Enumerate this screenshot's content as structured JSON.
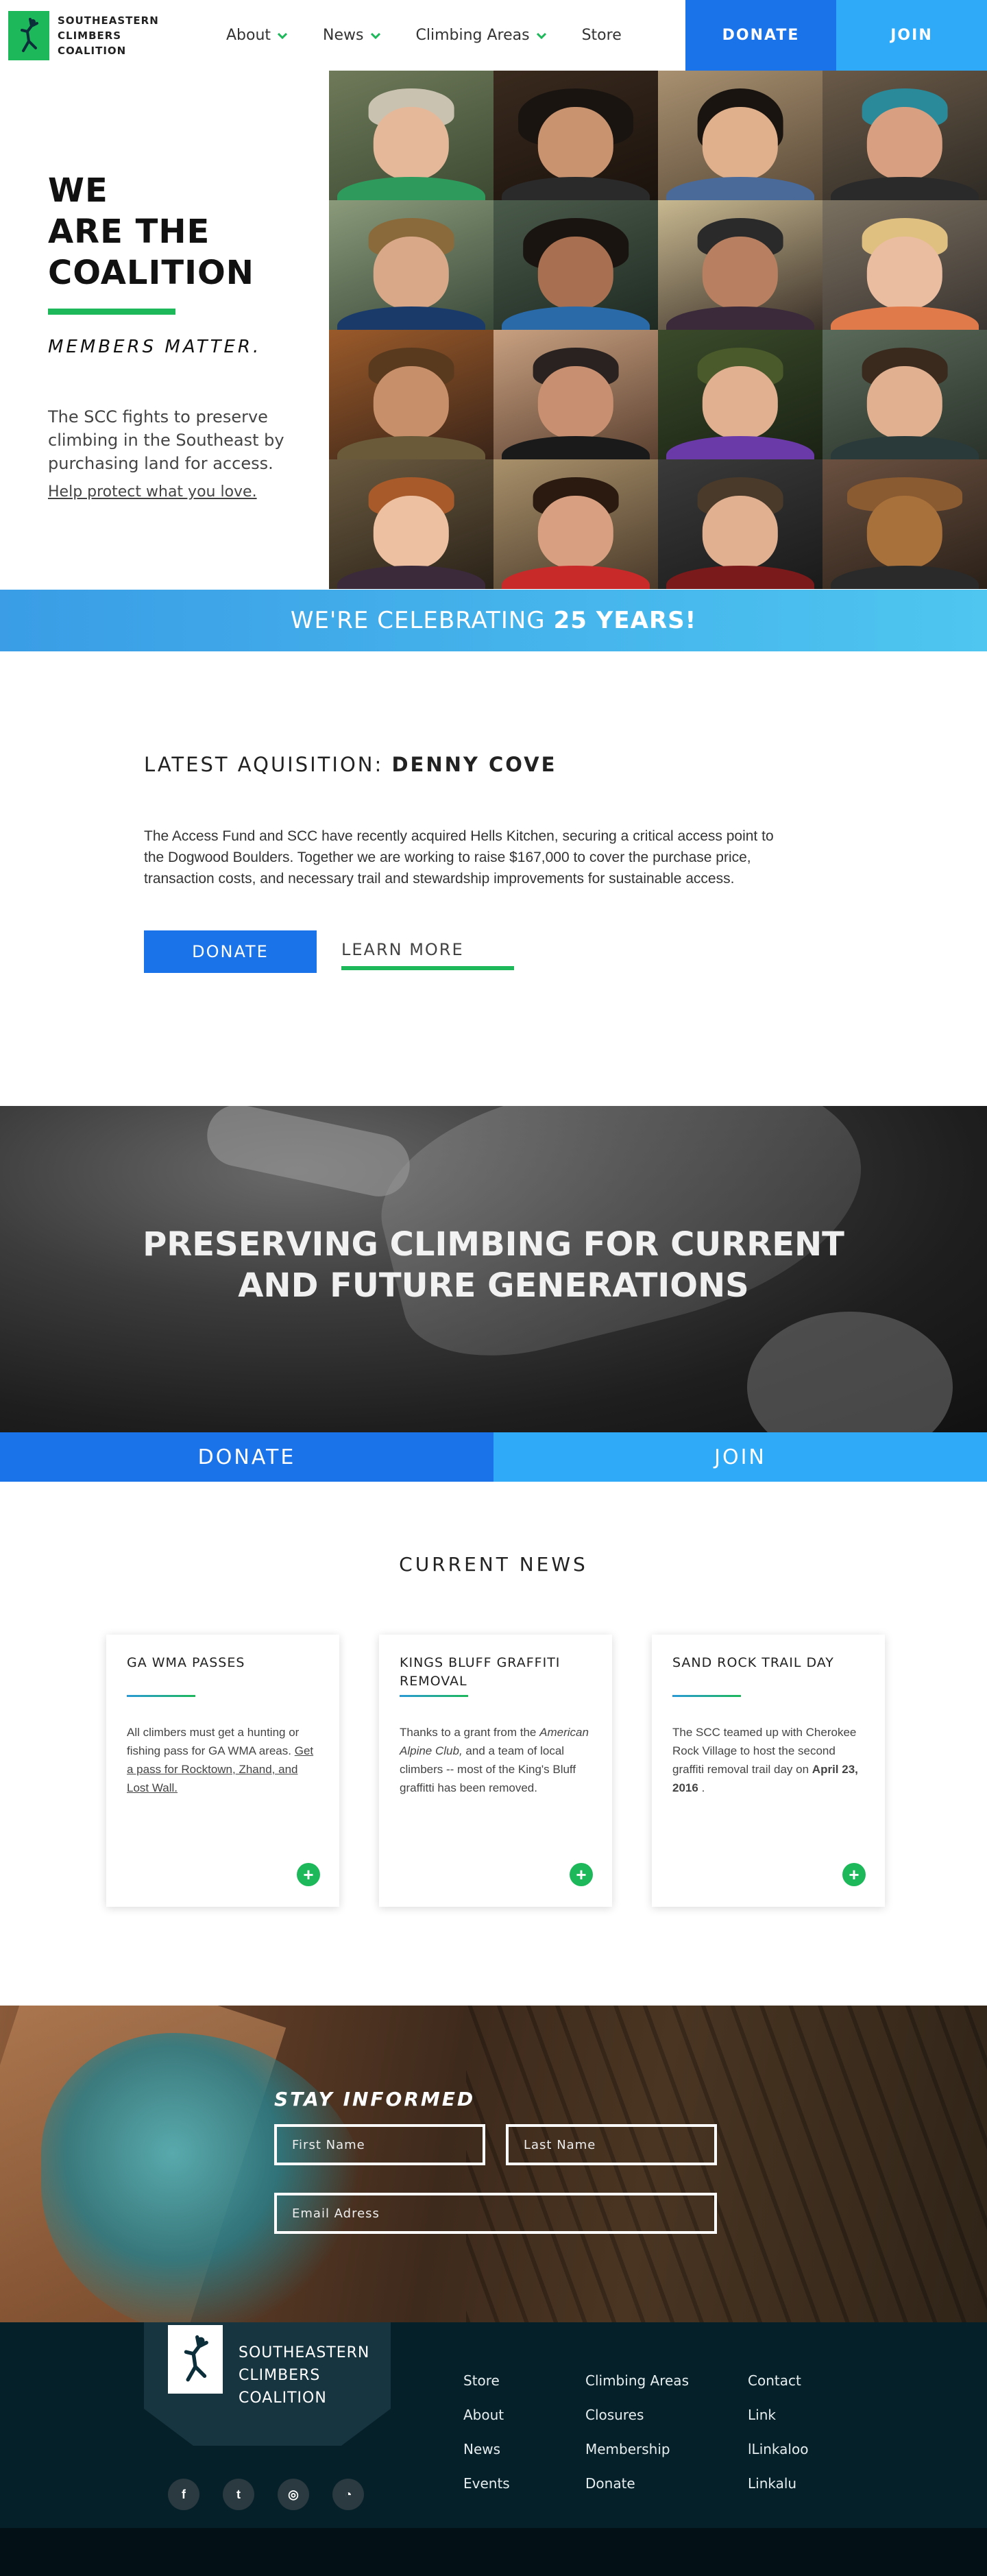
{
  "header": {
    "brand_name": "Southeastern Climbers Coalition",
    "nav": [
      {
        "label": "About",
        "has_dropdown": true
      },
      {
        "label": "News",
        "has_dropdown": true
      },
      {
        "label": "Climbing Areas",
        "has_dropdown": true
      },
      {
        "label": "Store",
        "has_dropdown": false
      }
    ],
    "donate_label": "Donate",
    "join_label": "Join"
  },
  "hero": {
    "title_line1": "We",
    "title_line2": "Are the",
    "title_line3": "Coalition",
    "subtitle": "Members Matter.",
    "description": "The SCC fights to preserve climbing in the Southeast by purchasing land for access.",
    "link": "Help protect what you love."
  },
  "celebrate": {
    "text": "We're celebrating",
    "highlight": "25 Years!"
  },
  "acquisition": {
    "label": "Latest Aquisition:",
    "name": "Denny Cove",
    "body": "The Access Fund and SCC have recently acquired Hells Kitchen, securing a critical access point to the Dogwood Boulders. Together we are working to raise $167,000 to cover the purchase price, transaction costs, and necessary trail and stewardship improvements for sustainable access.",
    "donate_label": "Donate",
    "learn_label": "Learn More"
  },
  "preserve": {
    "line1": "Preserving climbing for current",
    "line2": "and future generations"
  },
  "donate_join_bar": {
    "donate_label": "Donate",
    "join_label": "Join"
  },
  "news": {
    "title": "Current News",
    "cards": [
      {
        "title": "GA WMA Passes",
        "body": "All climbers must get a hunting or fishing pass for GA WMA areas.",
        "link": "Get a pass for Rocktown, Zhand, and Lost Wall."
      },
      {
        "title": "Kings Bluff Graffiti Removal",
        "body_pre": "Thanks to a grant from the",
        "body_em": "American Alpine Club,",
        "body_post": "and a team of local climbers -- most of the King's Bluff graffitti has been removed."
      },
      {
        "title": "Sand Rock Trail Day",
        "body": "The SCC teamed up with Cherokee Rock Village to host the second graffiti removal trail day on",
        "date": "April 23, 2016",
        "body_end": "."
      }
    ],
    "plus_glyph": "+"
  },
  "stay": {
    "title": "Stay Informed",
    "first_placeholder": "First Name",
    "last_placeholder": "Last Name",
    "email_placeholder": "Email Adress"
  },
  "footer": {
    "brand_name": "Southeastern Climbers Coalition",
    "socials": [
      {
        "icon": "facebook-icon",
        "glyph": "f"
      },
      {
        "icon": "twitter-icon",
        "glyph": "t"
      },
      {
        "icon": "instagram-icon",
        "glyph": "◎"
      },
      {
        "icon": "rss-icon",
        "glyph": "◔"
      }
    ],
    "col1": [
      "Store",
      "About",
      "News",
      "Events"
    ],
    "col2": [
      "Climbing Areas",
      "Closures",
      "Membership",
      "Donate"
    ],
    "col3": [
      "Contact",
      "Link",
      "lLinkaloo",
      "Linkalu"
    ]
  },
  "colors": {
    "green": "#1cb85a",
    "blue": "#1a73e8",
    "light_blue": "#2eaaf8",
    "footer_bg": "#062029"
  }
}
